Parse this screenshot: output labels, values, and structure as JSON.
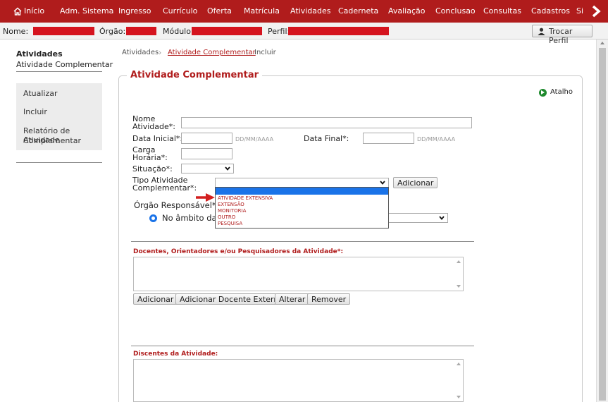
{
  "topnav": {
    "items": [
      "Início",
      "Adm. Sistema",
      "Ingresso",
      "Currículo",
      "Oferta",
      "Matrícula",
      "Atividades",
      "Caderneta",
      "Avaliação",
      "Conclusao",
      "Consultas",
      "Cadastros",
      "Si"
    ]
  },
  "infobar": {
    "nome_label": "Nome:",
    "orgao_label": "Órgão:",
    "modulo_label": "Módulo:",
    "perfil_label": "Perfil:",
    "trocar_perfil": "Trocar Perfil"
  },
  "sidebar": {
    "title": "Atividades",
    "subtitle": "Atividade Complementar",
    "items": [
      "Atualizar",
      "Incluir",
      "Relatório de Atividade",
      "Complementar"
    ]
  },
  "breadcrumb": {
    "items": [
      "Atividades",
      "Atividade Complementar",
      "Incluir"
    ]
  },
  "form": {
    "legend": "Atividade Complementar",
    "atalho": "Atalho",
    "nome_label_1": "Nome",
    "nome_label_2": "Atividade*:",
    "data_inicial_label": "Data Inicial*:",
    "data_final_label": "Data Final*:",
    "date_placeholder": "DD/MM/AAAA",
    "carga_label_1": "Carga",
    "carga_label_2": "Horária*:",
    "situacao_label": "Situação*:",
    "tipo_label_1": "Tipo Atividade",
    "tipo_label_2": "Complementar*:",
    "adicionar": "Adicionar",
    "tipo_options": [
      "ATIVIDADE EXTENSIVA",
      "EXTENSÃO",
      "MONITORIA",
      "OUTRO",
      "PESQUISA"
    ],
    "orgao_label": "Órgão Responsável*:",
    "radio_label": "No âmbito da i",
    "docentes_title": "Docentes, Orientadores e/ou Pesquisadores da Atividade*:",
    "docentes_buttons": [
      "Adicionar",
      "Adicionar Docente Externo",
      "Alterar",
      "Remover"
    ],
    "discentes_title": "Discentes da Atividade:"
  }
}
